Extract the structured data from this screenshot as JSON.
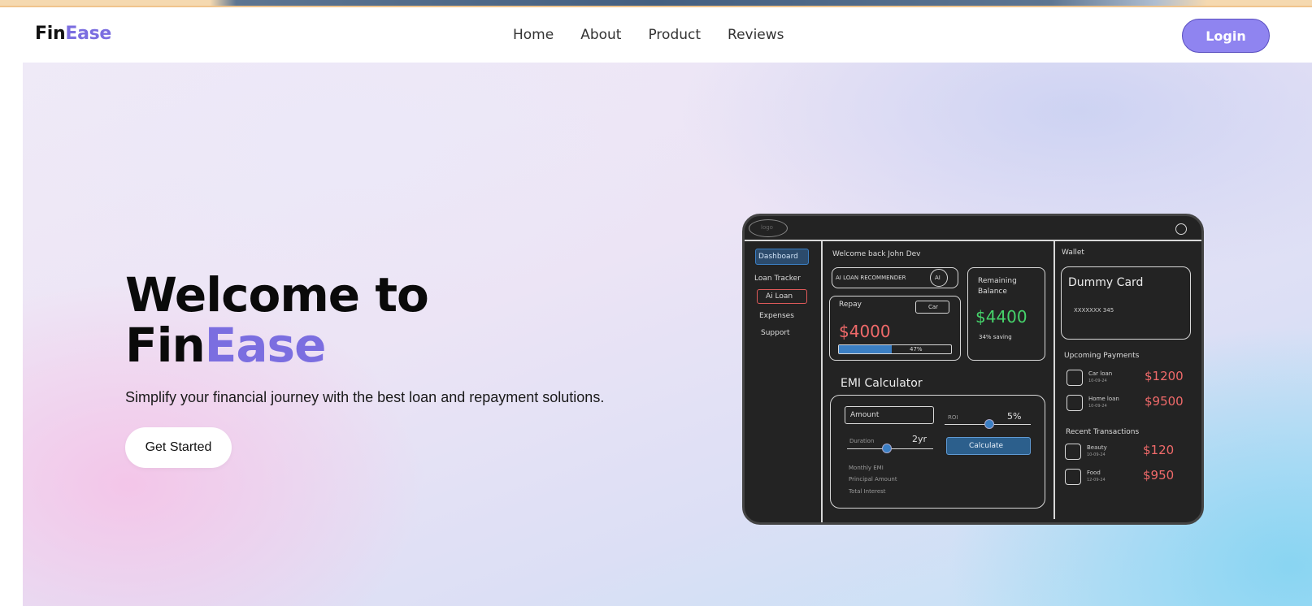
{
  "brand": {
    "name_part1": "Fin",
    "name_part2": "Ease"
  },
  "nav": {
    "links": [
      "Home",
      "About",
      "Product",
      "Reviews"
    ],
    "login_label": "Login"
  },
  "hero": {
    "title_line1": "Welcome to",
    "title_fin": "Fin",
    "title_ease": "Ease",
    "subtitle": "Simplify your financial journey with the best loan and repayment solutions.",
    "cta_label": "Get Started"
  },
  "mockup": {
    "logo_text": "logo",
    "sidebar": {
      "items": [
        "Dashboard",
        "Loan Tracker",
        "Ai Loan",
        "Expenses",
        "Support"
      ]
    },
    "welcome": "Welcome back John Dev",
    "ai_recommender": "AI LOAN RECOMMENDER",
    "ai_badge": "AI",
    "repay": {
      "label": "Repay",
      "tag": "Car",
      "amount": "$4000",
      "progress_label": "47%",
      "progress": 0.47
    },
    "balance": {
      "label_line1": "Remaining",
      "label_line2": "Balance",
      "amount": "$4400",
      "saving": "34% saving"
    },
    "emi": {
      "title": "EMI Calculator",
      "amount_placeholder": "Amount",
      "roi_label": "ROI",
      "roi_value": "5%",
      "duration_label": "Duration",
      "duration_value": "2yr",
      "calculate_label": "Calculate",
      "results": [
        "Monthly EMI",
        "Principal Amount",
        "Total Interest"
      ]
    },
    "wallet": {
      "label": "Wallet",
      "card_title": "Dummy Card",
      "card_number": "XXXXXXX 345"
    },
    "upcoming": {
      "title": "Upcoming Payments",
      "items": [
        {
          "name": "Car loan",
          "date": "10-09-24",
          "amount": "$1200"
        },
        {
          "name": "Home loan",
          "date": "10-09-24",
          "amount": "$9500"
        }
      ]
    },
    "recent": {
      "title": "Recent Transactions",
      "items": [
        {
          "name": "Beauty",
          "date": "10-09-24",
          "amount": "$120"
        },
        {
          "name": "Food",
          "date": "12-09-24",
          "amount": "$950"
        }
      ]
    }
  }
}
